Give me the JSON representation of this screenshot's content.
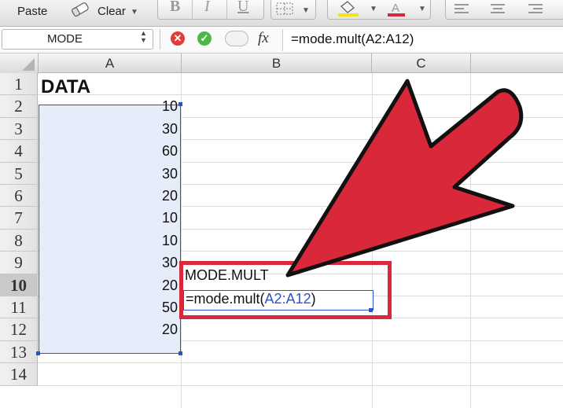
{
  "ribbon": {
    "paste_label": "Paste",
    "clear_label": "Clear",
    "bold_glyph": "B",
    "italic_glyph": "I",
    "underline_glyph": "U"
  },
  "formula_bar": {
    "name_box": "MODE",
    "fx_label": "fx",
    "formula": "=mode.mult(A2:A12)"
  },
  "columns": [
    "A",
    "B",
    "C"
  ],
  "rows": [
    "1",
    "2",
    "3",
    "4",
    "5",
    "6",
    "7",
    "8",
    "9",
    "10",
    "11",
    "12",
    "13",
    "14"
  ],
  "selected_row": "10",
  "column_a": {
    "header": "DATA",
    "values": [
      "10",
      "30",
      "60",
      "30",
      "20",
      "10",
      "10",
      "30",
      "20",
      "50",
      "20"
    ]
  },
  "column_b": {
    "b9": "MODE.MULT",
    "b10_prefix": "=mode.mult(",
    "b10_ref": "A2:A12",
    "b10_suffix": ")"
  },
  "colors": {
    "accent_blue": "#2a52cc",
    "selection_fill": "#e6ecfa",
    "annotation_red": "#d8283a"
  }
}
